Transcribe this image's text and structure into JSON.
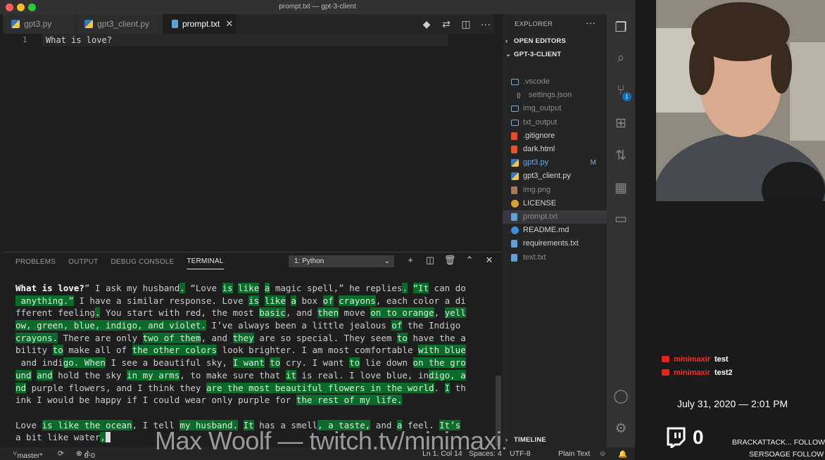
{
  "window": {
    "title": "prompt.txt — gpt-3-client"
  },
  "tabs": [
    {
      "label": "gpt3.py"
    },
    {
      "label": "gpt3_client.py"
    },
    {
      "label": "prompt.txt",
      "close": "✕"
    }
  ],
  "editor": {
    "line_number": "1",
    "line_text": "What is love?"
  },
  "panel": {
    "tabs": [
      "PROBLEMS",
      "OUTPUT",
      "DEBUG CONSOLE",
      "TERMINAL"
    ],
    "active_tab": "TERMINAL",
    "terminal_select": "1: Python"
  },
  "terminal": {
    "highlight_color": "#0b6b2b",
    "lines": [
      [
        [
          "b",
          "What is love?"
        ],
        [
          "n",
          "” I ask my husband"
        ],
        [
          "h",
          "."
        ],
        [
          "n",
          " “Love "
        ],
        [
          "h",
          "is"
        ],
        [
          "n",
          " "
        ],
        [
          "h",
          "like"
        ],
        [
          "n",
          " "
        ],
        [
          "h",
          "a"
        ],
        [
          "n",
          " magic spell,” he replies"
        ],
        [
          "h",
          "."
        ],
        [
          "n",
          " "
        ],
        [
          "h",
          "“It"
        ],
        [
          "n",
          " can do"
        ]
      ],
      [
        [
          "h",
          " anything.”"
        ],
        [
          "n",
          " I have a similar response. Love "
        ],
        [
          "h",
          "is"
        ],
        [
          "n",
          " "
        ],
        [
          "h",
          "like"
        ],
        [
          "n",
          " "
        ],
        [
          "h",
          "a"
        ],
        [
          "n",
          " box "
        ],
        [
          "h",
          "of"
        ],
        [
          "n",
          " "
        ],
        [
          "h",
          "crayons"
        ],
        [
          "n",
          ", each color a di"
        ]
      ],
      [
        [
          "n",
          "fferent feeling"
        ],
        [
          "h",
          "."
        ],
        [
          "n",
          " You start with red, the most "
        ],
        [
          "h",
          "basic"
        ],
        [
          "n",
          ", and "
        ],
        [
          "h",
          "then"
        ],
        [
          "n",
          " move "
        ],
        [
          "h",
          "on to orange"
        ],
        [
          "n",
          ", "
        ],
        [
          "h",
          "yell"
        ]
      ],
      [
        [
          "h",
          "ow, green, blue, indigo, and violet."
        ],
        [
          "n",
          " I’ve always been a little jealous "
        ],
        [
          "h",
          "of"
        ],
        [
          "n",
          " the Indigo "
        ]
      ],
      [
        [
          "h",
          "crayons."
        ],
        [
          "n",
          " There are only "
        ],
        [
          "h",
          "two of them"
        ],
        [
          "n",
          ", and "
        ],
        [
          "h",
          "they"
        ],
        [
          "n",
          " are so special. They seem "
        ],
        [
          "h",
          "to"
        ],
        [
          "n",
          " have the a"
        ]
      ],
      [
        [
          "n",
          "bility "
        ],
        [
          "h",
          "to"
        ],
        [
          "n",
          " make all of "
        ],
        [
          "h",
          "the other colors"
        ],
        [
          "n",
          " look brighter. I am most comfortable "
        ],
        [
          "h",
          "with blue"
        ]
      ],
      [
        [
          "n",
          " and indi"
        ],
        [
          "h",
          "go. When"
        ],
        [
          "n",
          " I see a beautiful sky, "
        ],
        [
          "h",
          "I want"
        ],
        [
          "n",
          " "
        ],
        [
          "h",
          "to"
        ],
        [
          "n",
          " cry. I want "
        ],
        [
          "h",
          "to"
        ],
        [
          "n",
          " lie down "
        ],
        [
          "h",
          "on the gro"
        ]
      ],
      [
        [
          "h",
          "und"
        ],
        [
          "n",
          " "
        ],
        [
          "h",
          "and"
        ],
        [
          "n",
          " hold the sky "
        ],
        [
          "h",
          "in my arms"
        ],
        [
          "n",
          ", to make sure that "
        ],
        [
          "h",
          "it"
        ],
        [
          "n",
          " is real. I love blue, in"
        ],
        [
          "h",
          "digo, a"
        ]
      ],
      [
        [
          "h",
          "nd"
        ],
        [
          "n",
          " purple flowers, and I think they "
        ],
        [
          "h",
          "are the most beautiful flowers in the world"
        ],
        [
          "n",
          ". "
        ],
        [
          "h",
          "I"
        ],
        [
          "n",
          " th"
        ]
      ],
      [
        [
          "n",
          "ink I would be happy if I could wear only purple for "
        ],
        [
          "h",
          "the rest of my life."
        ]
      ],
      [
        [
          "n",
          ""
        ]
      ],
      [
        [
          "n",
          "Love "
        ],
        [
          "h",
          "is like the ocean"
        ],
        [
          "n",
          ", I tell "
        ],
        [
          "h",
          "my husband."
        ],
        [
          "n",
          " "
        ],
        [
          "h",
          "It"
        ],
        [
          "n",
          " has a smell"
        ],
        [
          "h",
          ", a taste,"
        ],
        [
          "n",
          " and "
        ],
        [
          "h",
          "a"
        ],
        [
          "n",
          " feel. "
        ],
        [
          "h",
          "It’s"
        ]
      ],
      [
        [
          "n",
          "a bit like water"
        ],
        [
          "h",
          ","
        ],
        [
          "c",
          ""
        ]
      ]
    ]
  },
  "statusbar": {
    "branch": "master*",
    "errors": "0",
    "warnings": "0",
    "position": "Ln 1, Col 14",
    "spaces": "Spaces: 4",
    "encoding": "UTF-8",
    "language": "Plain Text"
  },
  "watermark": "Max Woolf — twitch.tv/minimaxir",
  "explorer": {
    "header": "EXPLORER",
    "open_editors": "OPEN EDITORS",
    "project": "GPT-3-CLIENT",
    "timeline": "TIMELINE",
    "files": [
      {
        "name": ".vscode",
        "icon": "folder-icon",
        "indent": 1,
        "dim": true
      },
      {
        "name": "settings.json",
        "icon": "json-icon",
        "indent": 2,
        "dim": true
      },
      {
        "name": "img_output",
        "icon": "folder-icon",
        "indent": 1,
        "dim": true
      },
      {
        "name": "txt_output",
        "icon": "folder-icon",
        "indent": 1,
        "dim": true
      },
      {
        "name": ".gitignore",
        "icon": "git-icon",
        "indent": 1
      },
      {
        "name": "dark.html",
        "icon": "html-icon",
        "indent": 1
      },
      {
        "name": "gpt3.py",
        "icon": "python-icon",
        "indent": 1,
        "badge": "M",
        "modified": true
      },
      {
        "name": "gpt3_client.py",
        "icon": "python-icon",
        "indent": 1
      },
      {
        "name": "img.png",
        "icon": "image-icon",
        "indent": 1,
        "dim": true
      },
      {
        "name": "LICENSE",
        "icon": "license-icon",
        "indent": 1
      },
      {
        "name": "prompt.txt",
        "icon": "text-file-icon",
        "indent": 1,
        "dim": true,
        "selected": true
      },
      {
        "name": "README.md",
        "icon": "info-icon",
        "indent": 1
      },
      {
        "name": "requirements.txt",
        "icon": "text-file-icon",
        "indent": 1
      },
      {
        "name": "text.txt",
        "icon": "text-file-icon",
        "indent": 1,
        "dim": true
      }
    ]
  },
  "activity": {
    "scm_badge": "1"
  },
  "stream": {
    "chat": [
      {
        "user": "minimaxir",
        "message": "test"
      },
      {
        "user": "minimaxir",
        "message": "test2"
      }
    ],
    "datetime": "July 31, 2020 — 2:01 PM",
    "viewer_count": "0",
    "ticker": [
      {
        "name": "BRACKATTACK...",
        "action": "FOLLOW"
      },
      {
        "name": "SERSOAGE",
        "action": "FOLLOW"
      }
    ]
  },
  "colors": {
    "accent": "#0e70c0",
    "highlight": "#0b6b2b",
    "stream_red": "#ff2a1f"
  }
}
